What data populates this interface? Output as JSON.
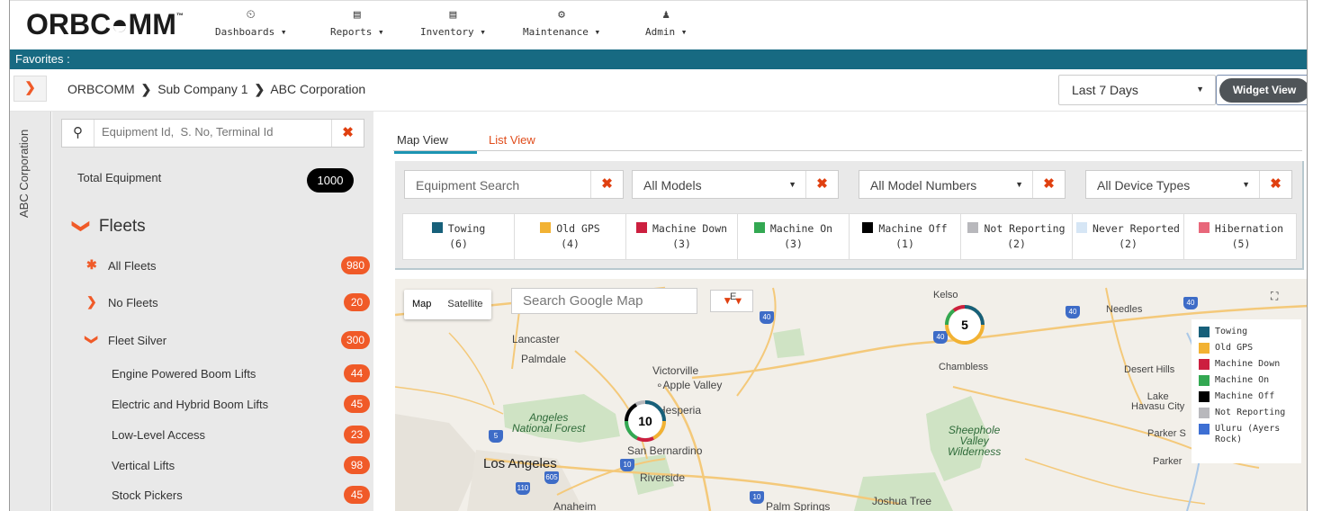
{
  "brand": {
    "logo_text": "ORBC◓MM",
    "trademark": "™"
  },
  "nav": [
    {
      "icon": "dashboard-icon",
      "glyph": "⏲",
      "label": "Dashboards ▾"
    },
    {
      "icon": "reports-icon",
      "glyph": "▤",
      "label": "Reports ▾"
    },
    {
      "icon": "inventory-icon",
      "glyph": "▤",
      "label": "Inventory ▾"
    },
    {
      "icon": "maintenance-icon",
      "glyph": "⚙",
      "label": "Maintenance ▾"
    },
    {
      "icon": "admin-icon",
      "glyph": "♟",
      "label": "Admin ▾"
    }
  ],
  "favorites_label": "Favorites :",
  "breadcrumb": {
    "items": [
      "ORBCOMM",
      "Sub Company 1",
      "ABC Corporation"
    ],
    "separator": "❯"
  },
  "date_range": {
    "value": "Last 7 Days",
    "caret": "▼"
  },
  "widget_view_label": "Widget View",
  "side_tab_label": "ABC Corporation",
  "expand_glyph": "❯",
  "equipment_search": {
    "placeholder": "Equipment Id,  S. No, Terminal Id",
    "icon_glyph": "⚲",
    "clear_glyph": "✖"
  },
  "total_equipment": {
    "label": "Total Equipment",
    "count": "1000"
  },
  "fleets": {
    "heading": "Fleets",
    "chevron": "❯",
    "items": [
      {
        "mark": "✱",
        "name": "All Fleets",
        "count": "980"
      },
      {
        "mark": "❯",
        "name": "No Fleets",
        "count": "20"
      },
      {
        "mark": "❯",
        "name": "Fleet Silver",
        "count": "300"
      },
      {
        "mark": "",
        "name": "Engine Powered Boom Lifts",
        "count": "44"
      },
      {
        "mark": "",
        "name": "Electric and Hybrid Boom Lifts",
        "count": "45"
      },
      {
        "mark": "",
        "name": "Low-Level Access",
        "count": "23"
      },
      {
        "mark": "",
        "name": "Vertical Lifts",
        "count": "98"
      },
      {
        "mark": "",
        "name": "Stock Pickers",
        "count": "45"
      }
    ]
  },
  "tabs": {
    "map": "Map View",
    "list": "List View"
  },
  "filters": {
    "equipment_search": "Equipment Search",
    "models": "All Models",
    "model_numbers": "All Model Numbers",
    "device_types": "All Device Types",
    "caret": "▼",
    "clear_glyph": "✖"
  },
  "status_legend": [
    {
      "label": "Towing",
      "count": "(6)",
      "color": "#17607a"
    },
    {
      "label": "Old GPS",
      "count": "(4)",
      "color": "#f2b233"
    },
    {
      "label": "Machine Down",
      "count": "(3)",
      "color": "#cc1f3f"
    },
    {
      "label": "Machine On",
      "count": "(3)",
      "color": "#33a852"
    },
    {
      "label": "Machine Off",
      "count": "(1)",
      "color": "#000000"
    },
    {
      "label": "Not Reporting",
      "count": "(2)",
      "color": "#b8b8bc"
    },
    {
      "label": "Never Reported",
      "count": "(2)",
      "color": "#d6e6f5"
    },
    {
      "label": "Hibernation",
      "count": "(5)",
      "color": "#e8677a"
    }
  ],
  "map": {
    "type_buttons": {
      "map": "Map",
      "satellite": "Satellite"
    },
    "search_placeholder": "Search Google Map",
    "filter_glyph": "▼ ▾",
    "fullscreen_glyph": "⛶",
    "legend": [
      {
        "label": "Towing",
        "color": "#17607a"
      },
      {
        "label": "Old GPS",
        "color": "#f2b233"
      },
      {
        "label": "Machine Down",
        "color": "#cc1f3f"
      },
      {
        "label": "Machine On",
        "color": "#33a852"
      },
      {
        "label": "Machine Off",
        "color": "#000000"
      },
      {
        "label": "Not Reporting",
        "color": "#b8b8bc"
      },
      {
        "label": "Uluru (Ayers Rock)",
        "color": "#3d6fd3"
      }
    ],
    "places": {
      "lancaster": "Lancaster",
      "palmdale": "Palmdale",
      "victorville": "Victorville",
      "apple_valley": "∘Apple Valley",
      "hesperia": "Hesperia",
      "angeles_forest": "Angeles\nNational Forest",
      "san_bernardino": "San Bernardino",
      "los_angeles": "Los Angeles",
      "riverside": "Riverside",
      "anaheim": "Anaheim",
      "palm_springs": "Palm Springs",
      "joshua_tree": "Joshua Tree",
      "kelso": "Kelso",
      "chambless": "Chambless",
      "needles": "Needles",
      "desert_hills": "Desert Hills",
      "lake_havasu": "Lake\nHavasu City",
      "parker_s": "Parker S",
      "parker": "Parker",
      "sheephole": "Sheephole\nValley\nWilderness",
      "e_label": "E"
    },
    "clusters": [
      {
        "count": "5"
      },
      {
        "count": "10"
      }
    ]
  }
}
